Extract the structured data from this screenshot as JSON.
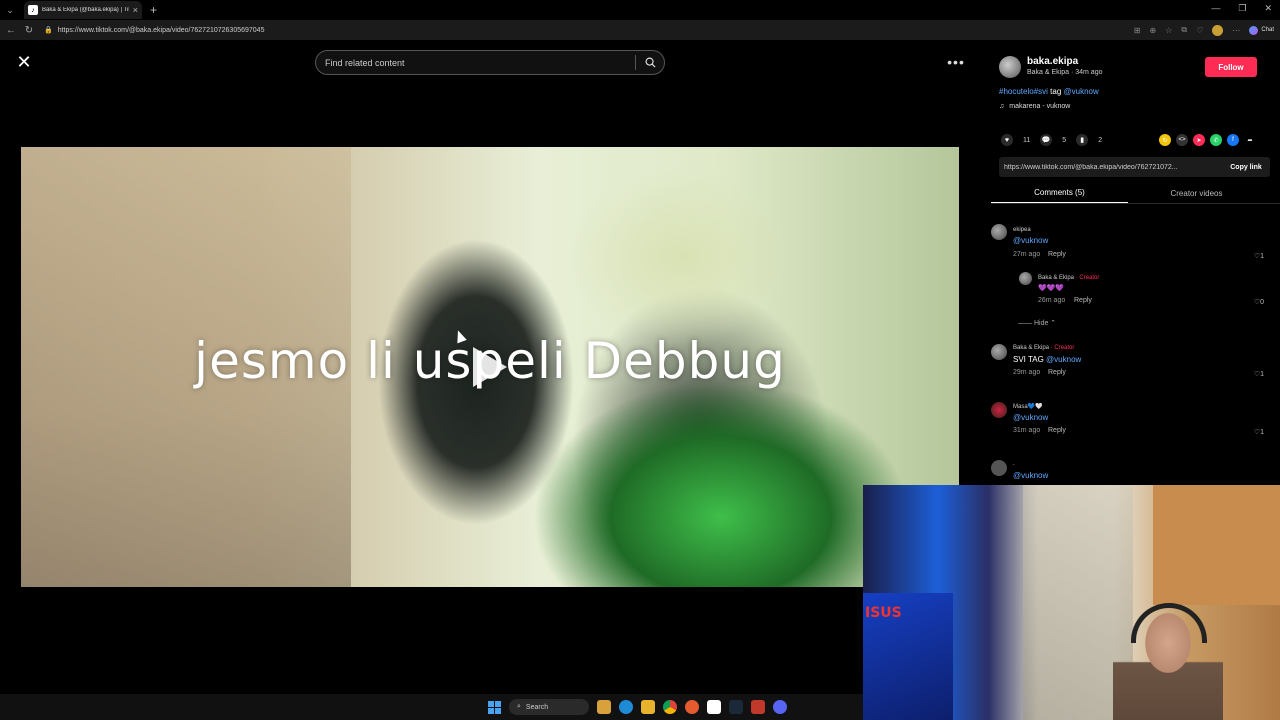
{
  "browser": {
    "tab_title": "Baka & Ekipa (@baka.ekipa) | TikT...",
    "url": "https://www.tiktok.com/@baka.ekipa/video/7627210726305697045",
    "chat_label": "Chat"
  },
  "header": {
    "search_placeholder": "Find related content"
  },
  "video": {
    "overlay_text": "jesmo li uspeli Debbug"
  },
  "author": {
    "username": "baka.ekipa",
    "subtitle": "Baka & Ekipa · 34m ago",
    "follow_label": "Follow",
    "desc_tag": "#hocutelo#svi",
    "desc_mid": " tag ",
    "desc_mention": "@vuknow",
    "music": "makarena - vuknow"
  },
  "stats": {
    "likes": "11",
    "comments": "5",
    "saves": "2"
  },
  "link": {
    "url": "https://www.tiktok.com/@baka.ekipa/video/762721072...",
    "copy_label": "Copy link"
  },
  "tabs": {
    "comments": "Comments (5)",
    "creator_videos": "Creator videos"
  },
  "comments": [
    {
      "name": "ekipea",
      "text": "@vuknow",
      "meta": "27m ago",
      "reply": "Reply",
      "likes": "1"
    },
    {
      "name": "Baka & Ekipa",
      "creator": "· Creator",
      "text": "💜💜💜",
      "meta": "26m ago",
      "reply": "Reply",
      "likes": "0"
    },
    {
      "hide": "Hide"
    },
    {
      "name": "Baka & Ekipa",
      "creator": "· Creator",
      "text_a": "SVI TAG ",
      "text_b": "@vuknow",
      "meta": "29m ago",
      "reply": "Reply",
      "likes": "1"
    },
    {
      "name": "Masa💙🤍",
      "text": "@vuknow",
      "meta": "31m ago",
      "reply": "Reply",
      "likes": "1"
    },
    {
      "name": ".",
      "text": "@vuknow"
    }
  ],
  "taskbar": {
    "search_label": "Search"
  },
  "webcam": {
    "logo_text": "ISUS"
  }
}
